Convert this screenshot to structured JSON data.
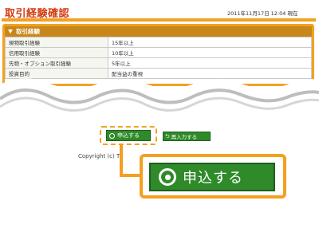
{
  "header": {
    "title": "取引経験確認",
    "timestamp": "2011年11月17日 12:04 現在"
  },
  "panel": {
    "title": "取引経験",
    "rows": [
      {
        "label": "現物取引経験",
        "value": "15年以上"
      },
      {
        "label": "信用取引経験",
        "value": "10年以上"
      },
      {
        "label": "先物・オプション取引経験",
        "value": "5年以上"
      },
      {
        "label": "投資目的",
        "value": "配当益の重視"
      }
    ]
  },
  "buttons": {
    "apply_label": "申込する",
    "reinput_label": "再入力する"
  },
  "footer": {
    "copyright": "Copyright (c) T"
  },
  "callout": {
    "apply_label": "申込する"
  },
  "colors": {
    "title_red": "#d43a10",
    "highlight_orange": "#f3a020",
    "button_green": "#2f8a2a",
    "header_brown": "#c8871a"
  },
  "icons": {
    "panel_header": "triangle-down-icon",
    "apply": "ring-icon",
    "reinput": "back-arrow-icon"
  }
}
